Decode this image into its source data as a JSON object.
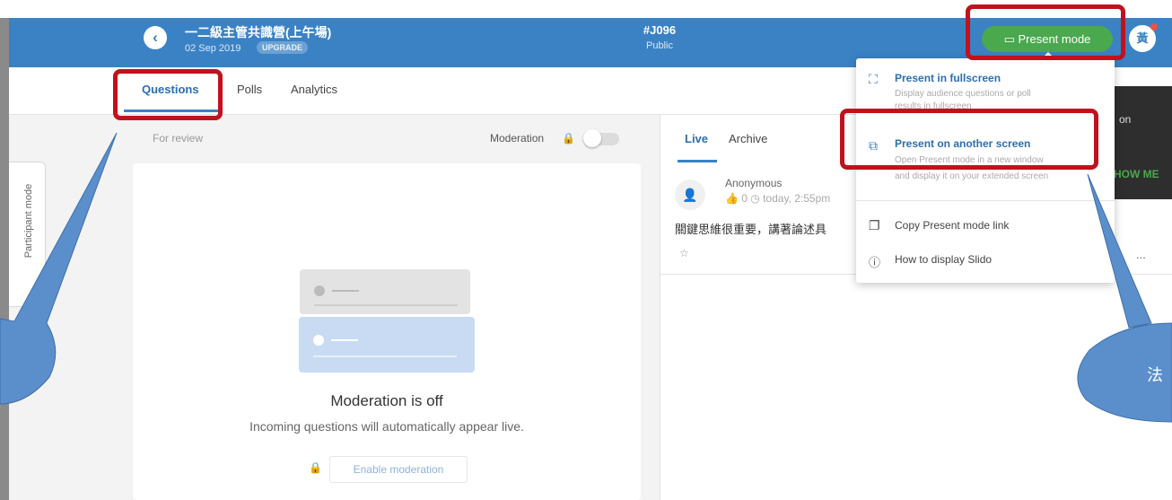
{
  "header": {
    "back_glyph": "‹",
    "event_title": "一二級主管共識營(上午場)",
    "event_date": "02 Sep 2019",
    "upgrade_label": "UPGRADE",
    "event_code": "#J096",
    "visibility": "Public",
    "present_mode_label": "Present mode",
    "present_icon": "screen-icon",
    "avatar_initial": "黃"
  },
  "tabs": {
    "questions": "Questions",
    "polls": "Polls",
    "analytics": "Analytics"
  },
  "sidebar": {
    "participant_mode_label": "Participant mode"
  },
  "review": {
    "for_review_label": "For review",
    "moderation_label": "Moderation",
    "moderation_off_title": "Moderation is off",
    "moderation_off_sub": "Incoming questions will automatically appear live.",
    "enable_moderation_label": "Enable moderation"
  },
  "live": {
    "live_tab": "Live",
    "archive_tab": "Archive",
    "question": {
      "author": "Anonymous",
      "meta": "👍 0  ◷ today, 2:55pm",
      "text": "關鍵思維很重要，講著論述具",
      "more": "..."
    }
  },
  "dark_panel": {
    "text": "on",
    "show_me": "HOW ME"
  },
  "menu": {
    "fullscreen_title": "Present in fullscreen",
    "fullscreen_desc1": "Display audience questions or poll",
    "fullscreen_desc2": "results in fullscreen",
    "another_title": "Present on another screen",
    "another_desc1": "Open Present mode in a new window",
    "another_desc2": "and display it on your extended screen",
    "copy_link": "Copy Present mode link",
    "how_to": "How to display Slido"
  },
  "callouts": {
    "right_text": "法"
  },
  "colors": {
    "header_blue": "#3a82c4",
    "present_green": "#4aa84e",
    "highlight_red": "#c0121c",
    "callout_blue": "#5a8fcc"
  }
}
